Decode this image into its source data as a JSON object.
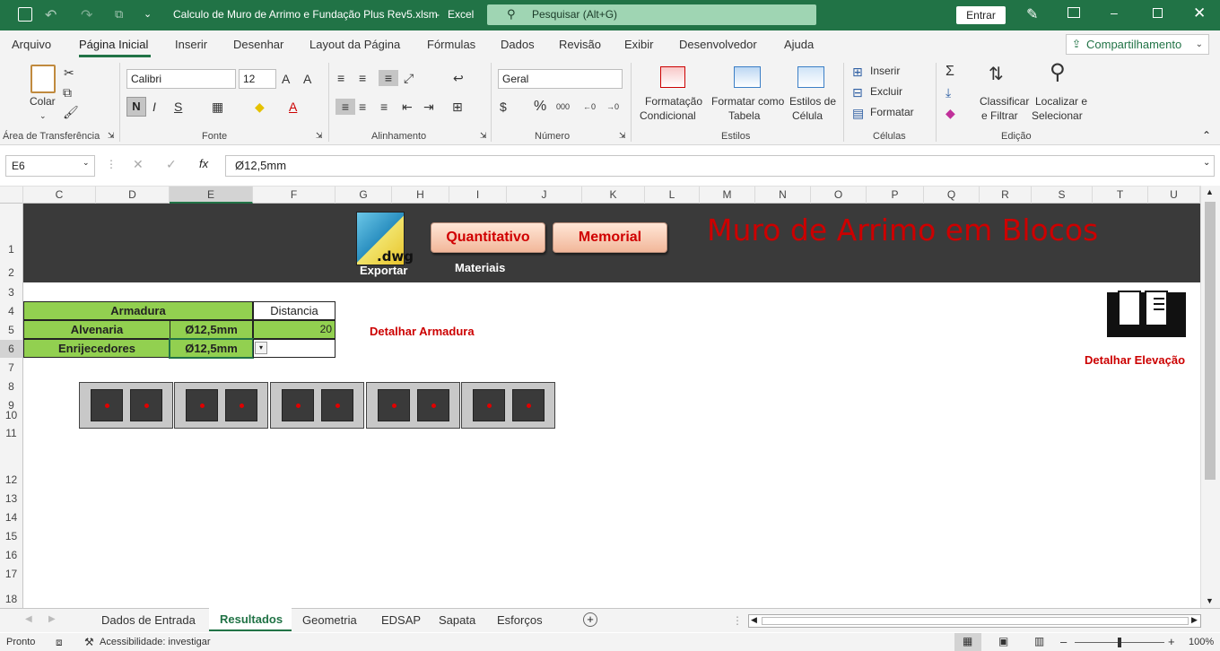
{
  "titlebar": {
    "filename": "Calculo de Muro de Arrimo e Fundação Plus Rev5.xlsm",
    "sep": "-",
    "app": "Excel",
    "search_placeholder": "Pesquisar (Alt+G)",
    "signin": "Entrar"
  },
  "menu": {
    "tabs": [
      "Arquivo",
      "Página Inicial",
      "Inserir",
      "Desenhar",
      "Layout da Página",
      "Fórmulas",
      "Dados",
      "Revisão",
      "Exibir",
      "Desenvolvedor",
      "Ajuda"
    ],
    "share": "Compartilhamento"
  },
  "ribbon": {
    "paste": "Colar",
    "groups": {
      "clipboard": "Área de Transferência",
      "font": "Fonte",
      "alignment": "Alinhamento",
      "number": "Número",
      "styles": "Estilos",
      "cells": "Células",
      "editing": "Edição"
    },
    "font_name": "Calibri",
    "font_size": "12",
    "bold": "N",
    "italic": "I",
    "underline": "S",
    "number_format": "Geral",
    "cond_format_1": "Formatação",
    "cond_format_2": "Condicional",
    "format_table_1": "Formatar como",
    "format_table_2": "Tabela",
    "cell_styles_1": "Estilos de",
    "cell_styles_2": "Célula",
    "insert": "Inserir",
    "delete": "Excluir",
    "format": "Formatar",
    "sort_1": "Classificar",
    "sort_2": "e Filtrar",
    "find_1": "Localizar e",
    "find_2": "Selecionar"
  },
  "formula_bar": {
    "name_box": "E6",
    "formula": "Ø12,5mm"
  },
  "columns": [
    "C",
    "D",
    "E",
    "F",
    "G",
    "H",
    "I",
    "J",
    "K",
    "L",
    "M",
    "N",
    "O",
    "P",
    "Q",
    "R",
    "S",
    "T",
    "U"
  ],
  "rows": [
    "1",
    "2",
    "3",
    "4",
    "5",
    "6",
    "7",
    "8",
    "9",
    "10",
    "11",
    "12",
    "13",
    "14",
    "15",
    "16",
    "17",
    "18"
  ],
  "sheet": {
    "title": "Muro de Arrimo em Blocos",
    "dwg_label": ".dwg",
    "exportar": "Exportar",
    "btn_quant": "Quantitativo",
    "btn_memorial": "Memorial",
    "materiais": "Materiais",
    "armadura": "Armadura",
    "distancia": "Distancia",
    "alvenaria": "Alvenaria",
    "alvenaria_val": "Ø12,5mm",
    "distancia_val": "20",
    "enrijecedores": "Enrijecedores",
    "enrijecedores_val": "Ø12,5mm",
    "detalhar_armadura": "Detalhar Armadura",
    "detalhar_elevacao": "Detalhar Elevação"
  },
  "sheet_tabs": [
    "Dados de Entrada",
    "Resultados",
    "Geometria",
    "EDSAP",
    "Sapata",
    "Esforços"
  ],
  "status": {
    "ready": "Pronto",
    "accessibility": "Acessibilidade: investigar",
    "zoom": "100%"
  },
  "colors": {
    "excel_green": "#217346",
    "banner": "#3a3a3a",
    "cell_green": "#92d050",
    "title_red": "#cc0000"
  }
}
